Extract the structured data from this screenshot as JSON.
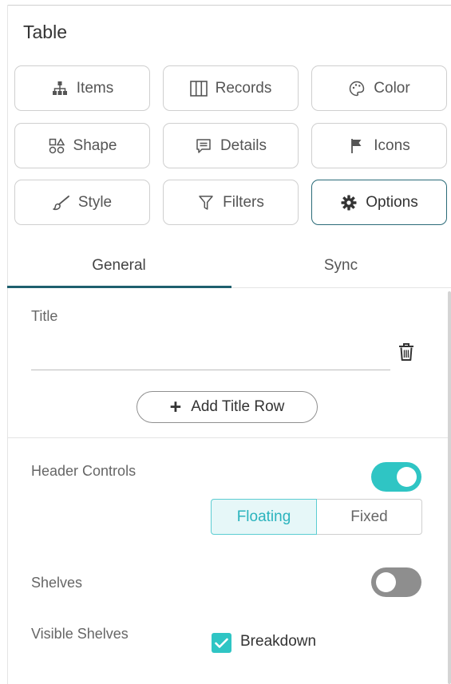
{
  "panel": {
    "title": "Table"
  },
  "buttons": [
    {
      "label": "Items",
      "icon": "hierarchy-icon"
    },
    {
      "label": "Records",
      "icon": "columns-icon"
    },
    {
      "label": "Color",
      "icon": "palette-icon"
    },
    {
      "label": "Shape",
      "icon": "shapes-icon"
    },
    {
      "label": "Details",
      "icon": "comment-icon"
    },
    {
      "label": "Icons",
      "icon": "flag-icon"
    },
    {
      "label": "Style",
      "icon": "brush-icon"
    },
    {
      "label": "Filters",
      "icon": "filter-icon"
    },
    {
      "label": "Options",
      "icon": "gear-icon",
      "active": true
    }
  ],
  "tabs": {
    "general": "General",
    "sync": "Sync",
    "active": "General"
  },
  "title_section": {
    "label": "Title",
    "value": "",
    "add_row_label": "Add Title Row"
  },
  "header_controls": {
    "label": "Header Controls",
    "enabled": true,
    "options": [
      "Floating",
      "Fixed"
    ],
    "selected": "Floating"
  },
  "shelves": {
    "label": "Shelves",
    "enabled": false
  },
  "visible_shelves": {
    "label": "Visible Shelves",
    "breakdown_label": "Breakdown",
    "breakdown_checked": true
  },
  "colors": {
    "accent": "#2fc5c4",
    "active_border": "#2a6b78",
    "tab_indicator": "#1e5f6e"
  }
}
